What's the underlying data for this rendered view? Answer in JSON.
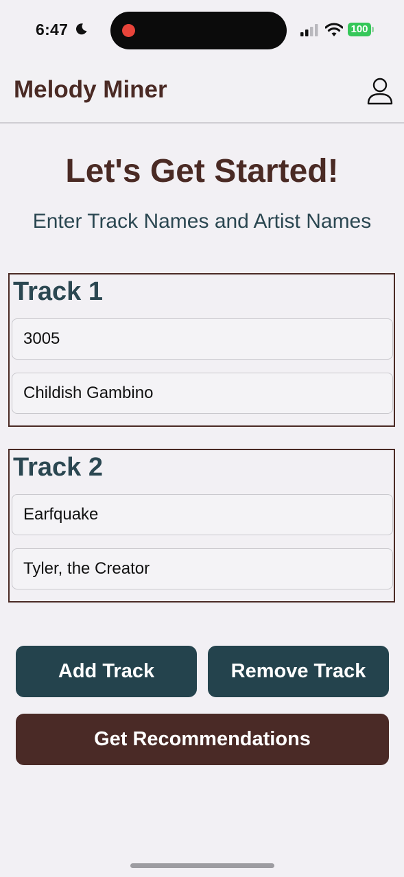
{
  "status_bar": {
    "time": "6:47",
    "battery": "100",
    "icons": [
      "moon-icon",
      "recording-dot-icon",
      "cellular-signal-icon",
      "wifi-icon",
      "battery-icon"
    ]
  },
  "header": {
    "app_title": "Melody Miner",
    "profile_icon": "user-icon"
  },
  "main": {
    "heading": "Let's Get Started!",
    "subheading": "Enter Track Names and Artist Names",
    "tracks": [
      {
        "title": "Track 1",
        "track_name": "3005",
        "artist_name": "Childish Gambino"
      },
      {
        "title": "Track 2",
        "track_name": "Earfquake",
        "artist_name": "Tyler, the Creator"
      }
    ]
  },
  "actions": {
    "add_label": "Add Track",
    "remove_label": "Remove Track",
    "recommend_label": "Get Recommendations"
  },
  "colors": {
    "background": "#f2f0f4",
    "brown": "#4a2a24",
    "teal": "#24434d",
    "battery_green": "#35c759",
    "record_red": "#e8443a"
  }
}
